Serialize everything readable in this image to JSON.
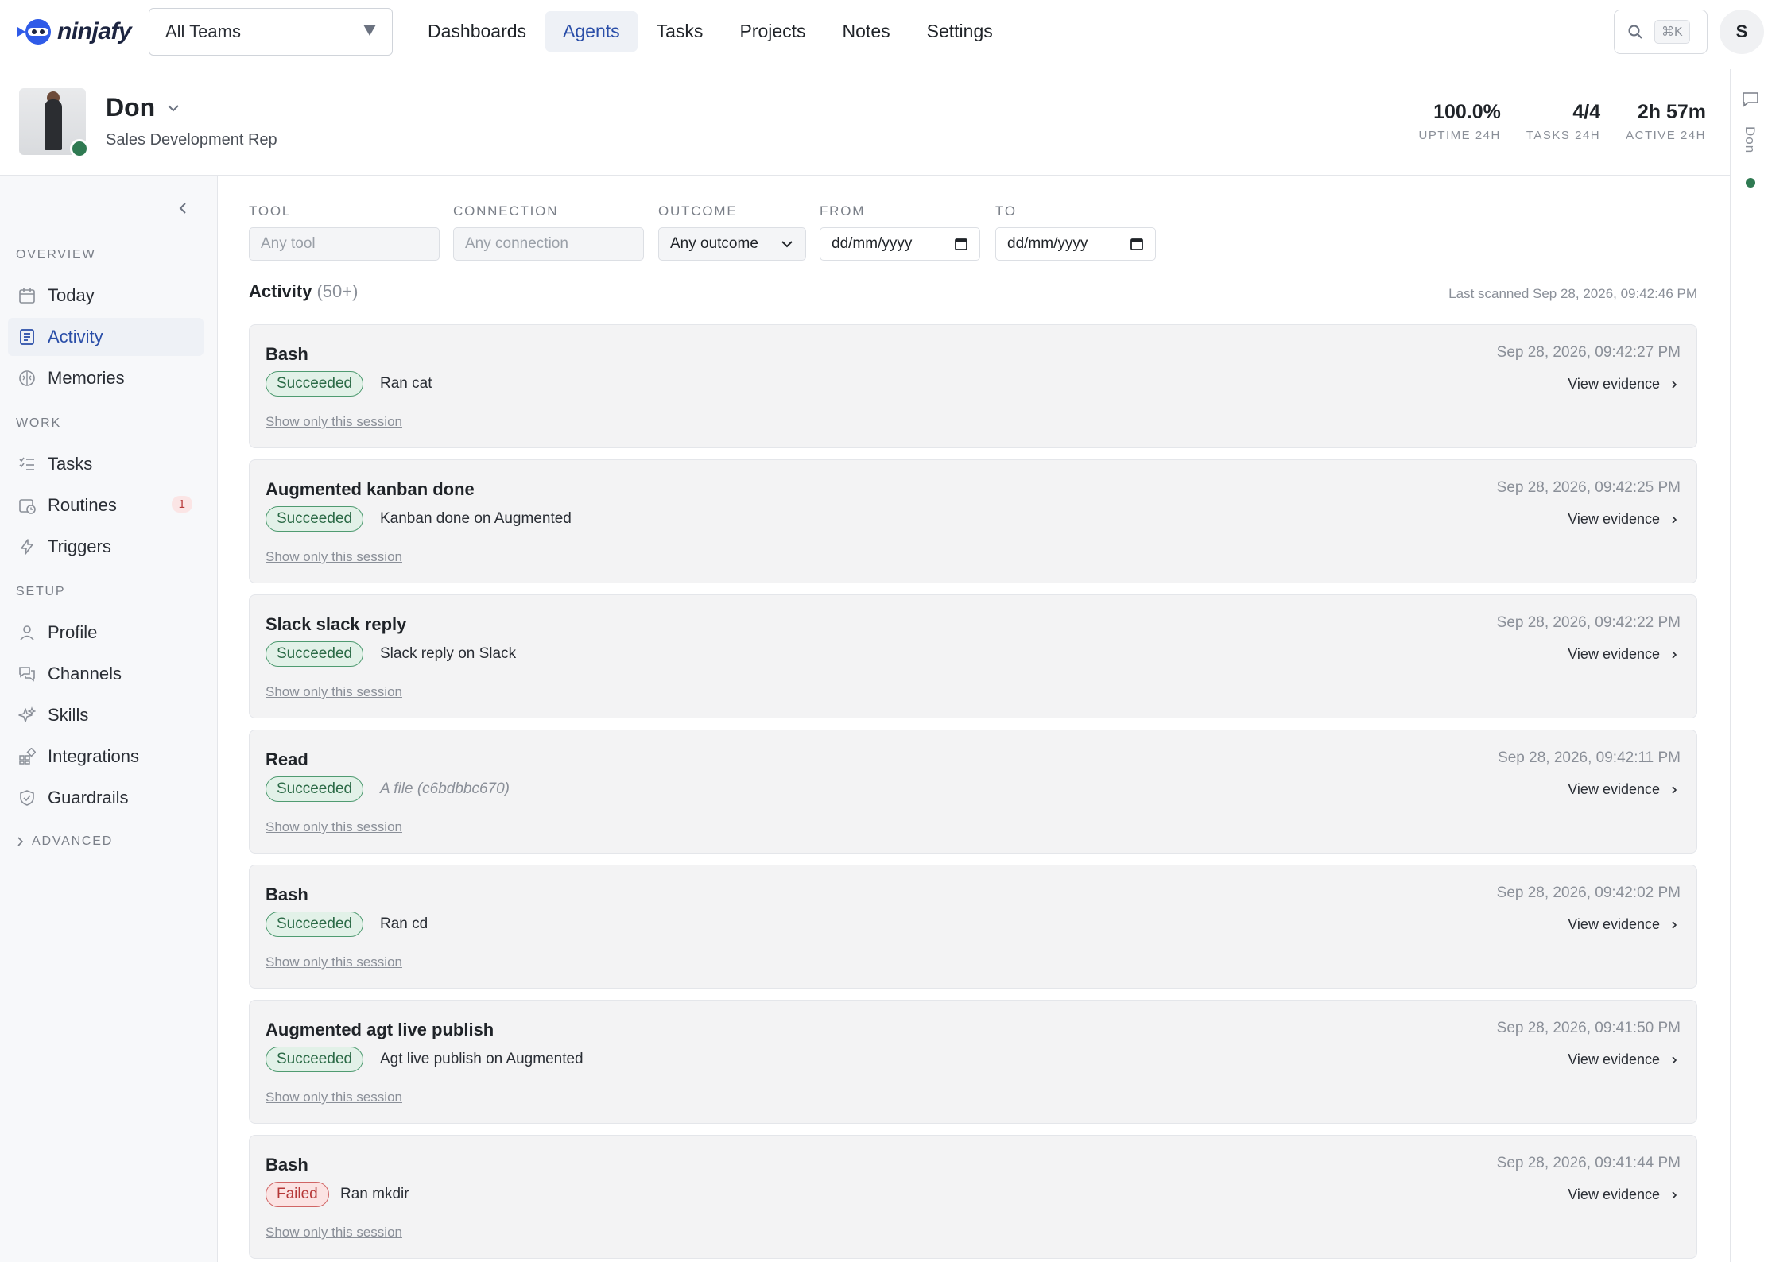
{
  "brand": {
    "name": "ninjafy",
    "accent": "#2f5be8"
  },
  "team_select": {
    "value": "All Teams"
  },
  "nav": [
    "Dashboards",
    "Agents",
    "Tasks",
    "Projects",
    "Notes",
    "Settings"
  ],
  "nav_active": "Agents",
  "search": {
    "shortcut": "⌘K"
  },
  "user_avatar": "S",
  "agent": {
    "name": "Don",
    "role": "Sales Development Rep",
    "stats": [
      {
        "value": "100.0%",
        "label": "UPTIME 24H"
      },
      {
        "value": "4/4",
        "label": "TASKS 24H"
      },
      {
        "value": "2h 57m",
        "label": "ACTIVE 24H"
      }
    ]
  },
  "right_rail": {
    "label": "Don"
  },
  "sidebar": {
    "sections": [
      {
        "title": "OVERVIEW",
        "items": [
          {
            "label": "Today",
            "icon": "calendar-icon"
          },
          {
            "label": "Activity",
            "icon": "activity-icon",
            "active": true
          },
          {
            "label": "Memories",
            "icon": "brain-icon"
          }
        ]
      },
      {
        "title": "WORK",
        "items": [
          {
            "label": "Tasks",
            "icon": "checklist-icon"
          },
          {
            "label": "Routines",
            "icon": "calendar-clock-icon",
            "badge": "1"
          },
          {
            "label": "Triggers",
            "icon": "lightning-icon"
          }
        ]
      },
      {
        "title": "SETUP",
        "items": [
          {
            "label": "Profile",
            "icon": "user-icon"
          },
          {
            "label": "Channels",
            "icon": "chat-icon"
          },
          {
            "label": "Skills",
            "icon": "sparkle-icon"
          },
          {
            "label": "Integrations",
            "icon": "grid-plus-icon"
          },
          {
            "label": "Guardrails",
            "icon": "shield-icon"
          }
        ]
      }
    ],
    "advanced": "ADVANCED"
  },
  "filters": {
    "tool": {
      "label": "TOOL",
      "placeholder": "Any tool"
    },
    "connection": {
      "label": "CONNECTION",
      "placeholder": "Any connection"
    },
    "outcome": {
      "label": "OUTCOME",
      "value": "Any outcome"
    },
    "from": {
      "label": "FROM",
      "value": "dd/mm/yyyy"
    },
    "to": {
      "label": "TO",
      "value": "dd/mm/yyyy"
    }
  },
  "activity": {
    "title": "Activity",
    "count": "(50+)",
    "last_scanned": "Last scanned Sep 28, 2026, 09:42:46 PM",
    "evidence_label": "View evidence",
    "session_label": "Show only this session",
    "items": [
      {
        "title": "Bash",
        "status": "Succeeded",
        "desc": "Ran cat",
        "time": "Sep 28, 2026, 09:42:27 PM"
      },
      {
        "title": "Augmented kanban done",
        "status": "Succeeded",
        "desc": "Kanban done on Augmented",
        "time": "Sep 28, 2026, 09:42:25 PM"
      },
      {
        "title": "Slack slack reply",
        "status": "Succeeded",
        "desc": "Slack reply on Slack",
        "time": "Sep 28, 2026, 09:42:22 PM"
      },
      {
        "title": "Read",
        "status": "Succeeded",
        "desc": "A file (c6bdbbc670)",
        "italic": true,
        "time": "Sep 28, 2026, 09:42:11 PM"
      },
      {
        "title": "Bash",
        "status": "Succeeded",
        "desc": "Ran cd",
        "time": "Sep 28, 2026, 09:42:02 PM"
      },
      {
        "title": "Augmented agt live publish",
        "status": "Succeeded",
        "desc": "Agt live publish on Augmented",
        "time": "Sep 28, 2026, 09:41:50 PM"
      },
      {
        "title": "Bash",
        "status": "Failed",
        "desc": "Ran mkdir",
        "time": "Sep 28, 2026, 09:41:44 PM"
      }
    ]
  }
}
